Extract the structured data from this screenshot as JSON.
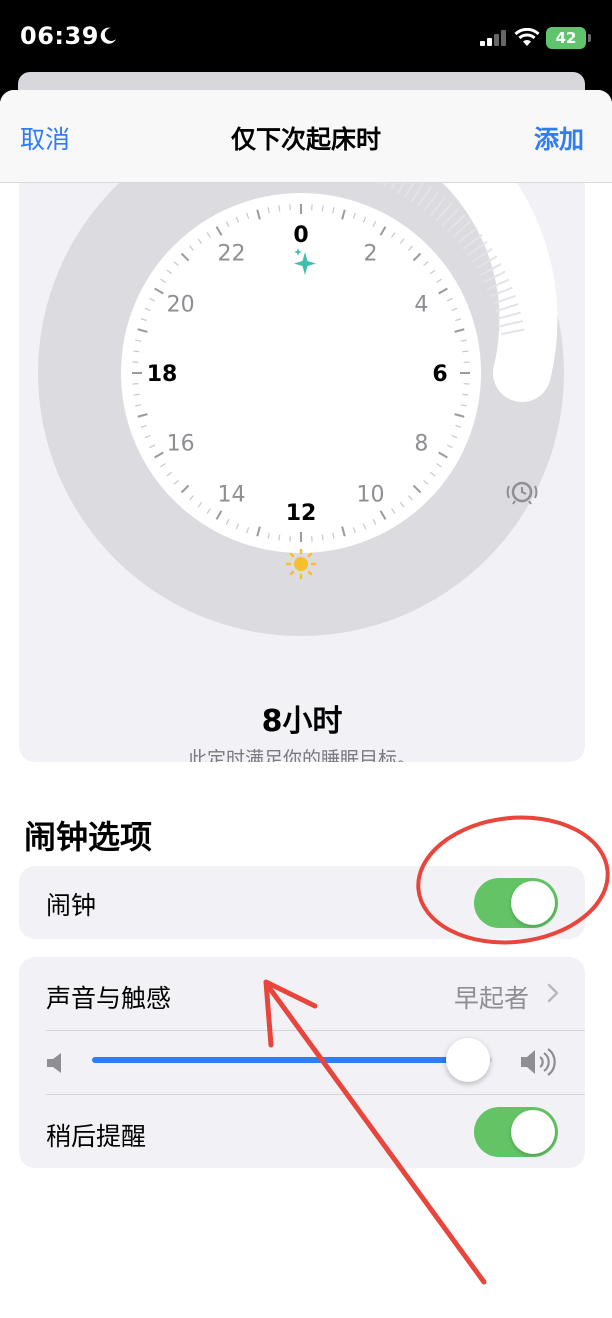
{
  "status_bar": {
    "time": "06:39",
    "battery": "42",
    "icons": [
      "moon-icon",
      "signal-icon",
      "wifi-icon",
      "battery-icon"
    ]
  },
  "nav": {
    "cancel": "取消",
    "title": "仅下次起床时",
    "add": "添加"
  },
  "clock": {
    "hour_labels": [
      "0",
      "2",
      "4",
      "6",
      "8",
      "10",
      "12",
      "14",
      "16",
      "18",
      "20",
      "22"
    ],
    "icons": [
      "sparkle-icon",
      "sun-icon",
      "alarm-clock-icon"
    ],
    "duration": "8小时",
    "duration_note": "此定时满足你的睡眠目标。"
  },
  "alarm_options": {
    "header": "闹钟选项",
    "alarm_label": "闹钟",
    "alarm_on": true,
    "sound_label": "声音与触感",
    "sound_value": "早起者",
    "volume_level": 0.94,
    "snooze_label": "稍后提醒",
    "snooze_on": true
  },
  "colors": {
    "accent_blue": "#2f7cf6",
    "toggle_green": "#63c466",
    "annotation_red": "#e8453c",
    "sparkle_teal": "#3ebfae",
    "sun_yellow": "#f6c02c"
  }
}
